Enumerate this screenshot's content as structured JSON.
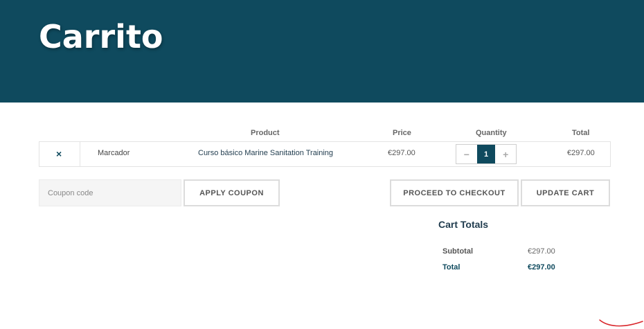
{
  "page": {
    "title": "Carrito"
  },
  "table": {
    "headers": {
      "product": "Product",
      "price": "Price",
      "quantity": "Quantity",
      "total": "Total"
    },
    "rows": [
      {
        "remove": "×",
        "image_alt": "Marcador",
        "product": "Curso básico Marine Sanitation Training",
        "price": "€297.00",
        "quantity": "1",
        "total": "€297.00"
      }
    ]
  },
  "qty_controls": {
    "minus": "−",
    "plus": "+"
  },
  "coupon": {
    "placeholder": "Coupon code",
    "apply_label": "APPLY COUPON"
  },
  "actions": {
    "checkout_label": "PROCEED TO CHECKOUT",
    "update_label": "UPDATE CART"
  },
  "totals": {
    "title": "Cart Totals",
    "subtotal_label": "Subtotal",
    "subtotal_value": "€297.00",
    "total_label": "Total",
    "total_value": "€297.00"
  },
  "colors": {
    "brand": "#0f4a5e",
    "annotation": "#d9262b"
  }
}
